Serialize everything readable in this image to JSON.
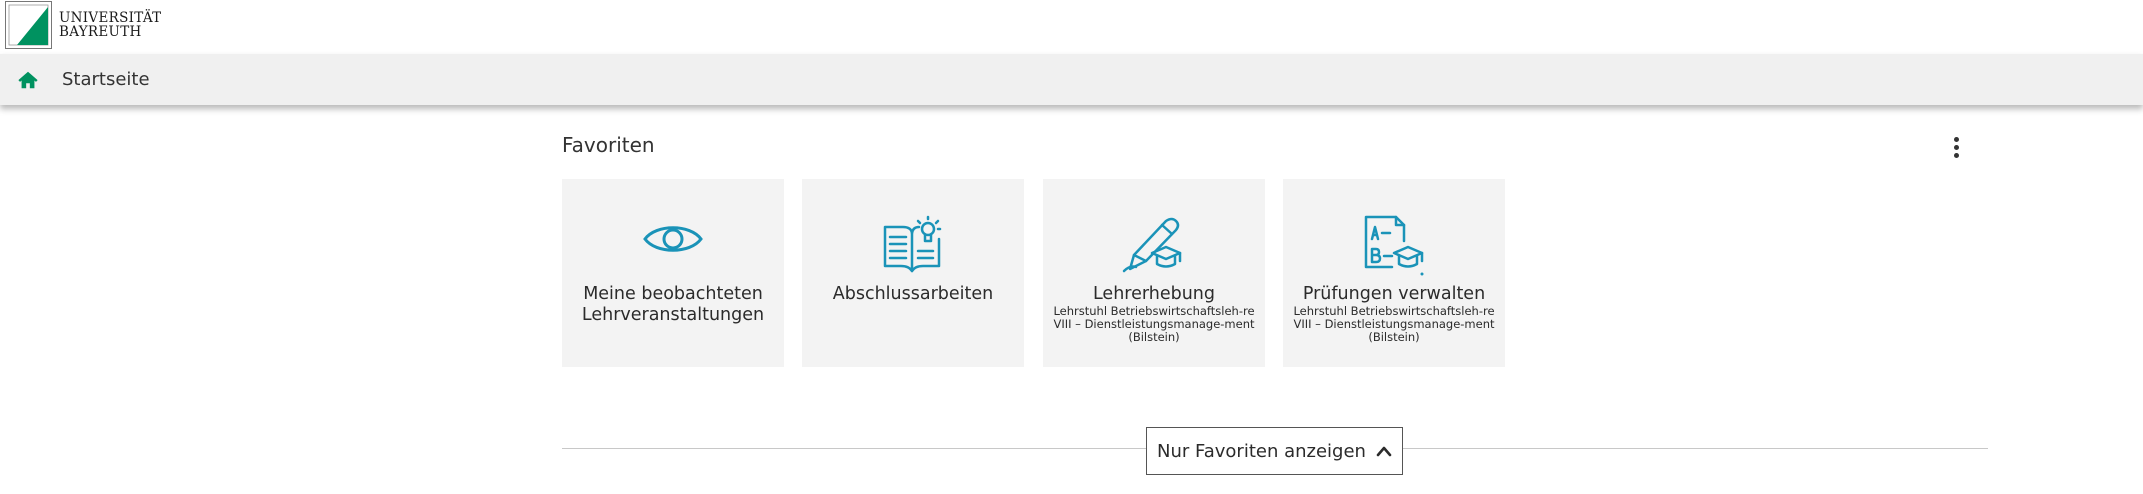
{
  "header": {
    "logo_line1": "UNIVERSITÄT",
    "logo_line2": "BAYREUTH",
    "brand_color": "#009260"
  },
  "nav": {
    "title": "Startseite"
  },
  "favorites": {
    "title": "Favoriten",
    "tiles": [
      {
        "title": "Meine beobachteten Lehrveranstaltungen",
        "subtitle": "",
        "icon": "eye-icon"
      },
      {
        "title": "Abschlussarbeiten",
        "subtitle": "",
        "icon": "book-idea-icon"
      },
      {
        "title": "Lehrerhebung",
        "subtitle": "Lehrstuhl Betriebswirtschaftsleh-re VIII – Dienstleistungsmanage-ment (Bilstein)",
        "icon": "pencil-graduation-icon"
      },
      {
        "title": "Prüfungen verwalten",
        "subtitle": "Lehrstuhl Betriebswirtschaftsleh-re VIII – Dienstleistungsmanage-ment (Bilstein)",
        "icon": "exam-graduation-icon"
      }
    ],
    "toggle_label": "Nur Favoriten anzeigen",
    "icon_color": "#1a93b8"
  }
}
